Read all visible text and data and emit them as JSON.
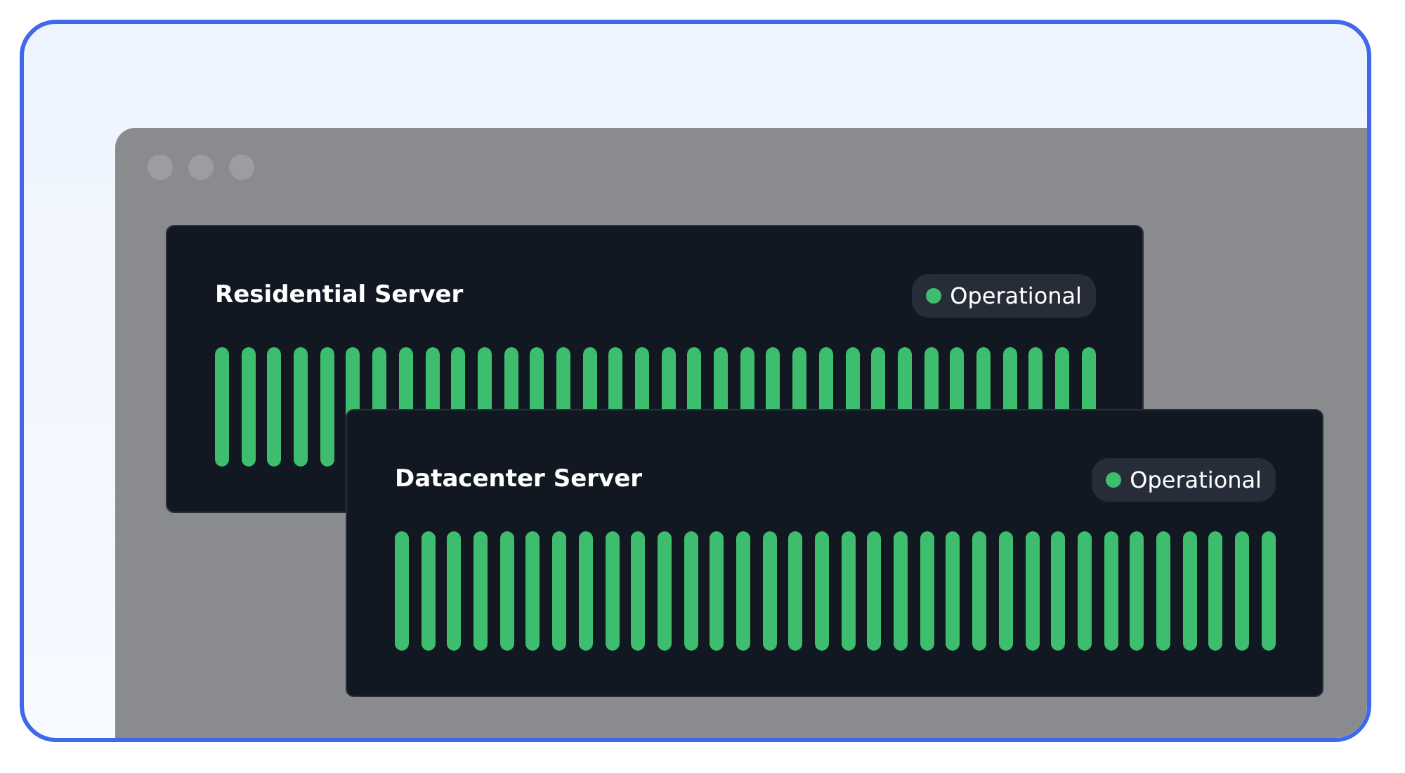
{
  "servers": [
    {
      "name": "Residential Server",
      "status": {
        "label": "Operational",
        "up": true
      },
      "bars": [
        {
          "up": true
        },
        {
          "up": true
        },
        {
          "up": true
        },
        {
          "up": true
        },
        {
          "up": true
        },
        {
          "up": true
        },
        {
          "up": true
        },
        {
          "up": true
        },
        {
          "up": true
        },
        {
          "up": true
        },
        {
          "up": true
        },
        {
          "up": true
        },
        {
          "up": true
        },
        {
          "up": true
        },
        {
          "up": true
        },
        {
          "up": true
        },
        {
          "up": true
        },
        {
          "up": true
        },
        {
          "up": true
        },
        {
          "up": true
        },
        {
          "up": true
        },
        {
          "up": true
        },
        {
          "up": true
        },
        {
          "up": true
        },
        {
          "up": true
        },
        {
          "up": true
        },
        {
          "up": true
        },
        {
          "up": true
        },
        {
          "up": true
        },
        {
          "up": true
        },
        {
          "up": true
        },
        {
          "up": true
        },
        {
          "up": true
        },
        {
          "up": true
        }
      ]
    },
    {
      "name": "Datacenter Server",
      "status": {
        "label": "Operational",
        "up": true
      },
      "bars": [
        {
          "up": true
        },
        {
          "up": true
        },
        {
          "up": true
        },
        {
          "up": true
        },
        {
          "up": true
        },
        {
          "up": true
        },
        {
          "up": true
        },
        {
          "up": true
        },
        {
          "up": true
        },
        {
          "up": true
        },
        {
          "up": true
        },
        {
          "up": true
        },
        {
          "up": true
        },
        {
          "up": true
        },
        {
          "up": true
        },
        {
          "up": true
        },
        {
          "up": true
        },
        {
          "up": true
        },
        {
          "up": true
        },
        {
          "up": true
        },
        {
          "up": true
        },
        {
          "up": true
        },
        {
          "up": true
        },
        {
          "up": true
        },
        {
          "up": true
        },
        {
          "up": true
        },
        {
          "up": true
        },
        {
          "up": true
        },
        {
          "up": true
        },
        {
          "up": true
        },
        {
          "up": true
        },
        {
          "up": true
        },
        {
          "up": true
        },
        {
          "up": true
        }
      ]
    }
  ]
}
